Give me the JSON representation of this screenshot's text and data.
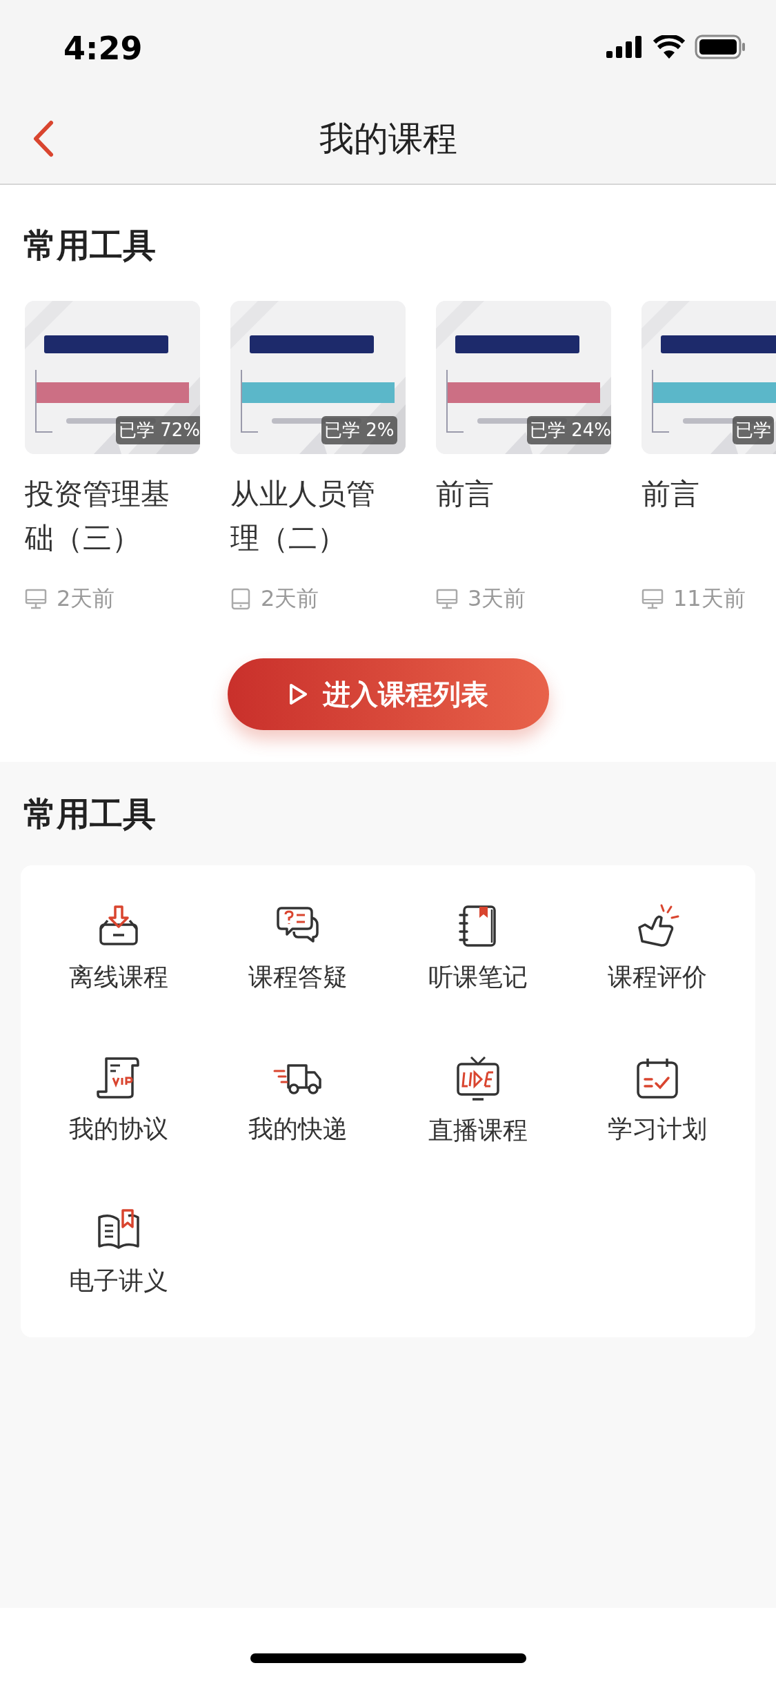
{
  "status_bar": {
    "time": "4:29"
  },
  "nav": {
    "title": "我的课程"
  },
  "courses_section": {
    "title": "常用工具",
    "courses": [
      {
        "progress": "已学 72%",
        "title": "投资管理基础（三）",
        "kind": "desktop",
        "time": "2天前"
      },
      {
        "progress": "已学 2%",
        "title": "从业人员管理（二）",
        "kind": "tablet",
        "time": "2天前"
      },
      {
        "progress": "已学 24%",
        "title": "前言",
        "kind": "desktop",
        "time": "3天前"
      },
      {
        "progress": "已学",
        "title": "前言",
        "kind": "desktop",
        "time": "11天前"
      }
    ],
    "button": "进入课程列表"
  },
  "tools_section": {
    "title": "常用工具",
    "tools": [
      {
        "label": "离线课程",
        "kind": "download"
      },
      {
        "label": "课程答疑",
        "kind": "chat"
      },
      {
        "label": "听课笔记",
        "kind": "notebook"
      },
      {
        "label": "课程评价",
        "kind": "thumb"
      },
      {
        "label": "我的协议",
        "kind": "vip"
      },
      {
        "label": "我的快递",
        "kind": "truck"
      },
      {
        "label": "直播课程",
        "kind": "live"
      },
      {
        "label": "学习计划",
        "kind": "calendar"
      },
      {
        "label": "电子讲义",
        "kind": "book"
      }
    ]
  }
}
